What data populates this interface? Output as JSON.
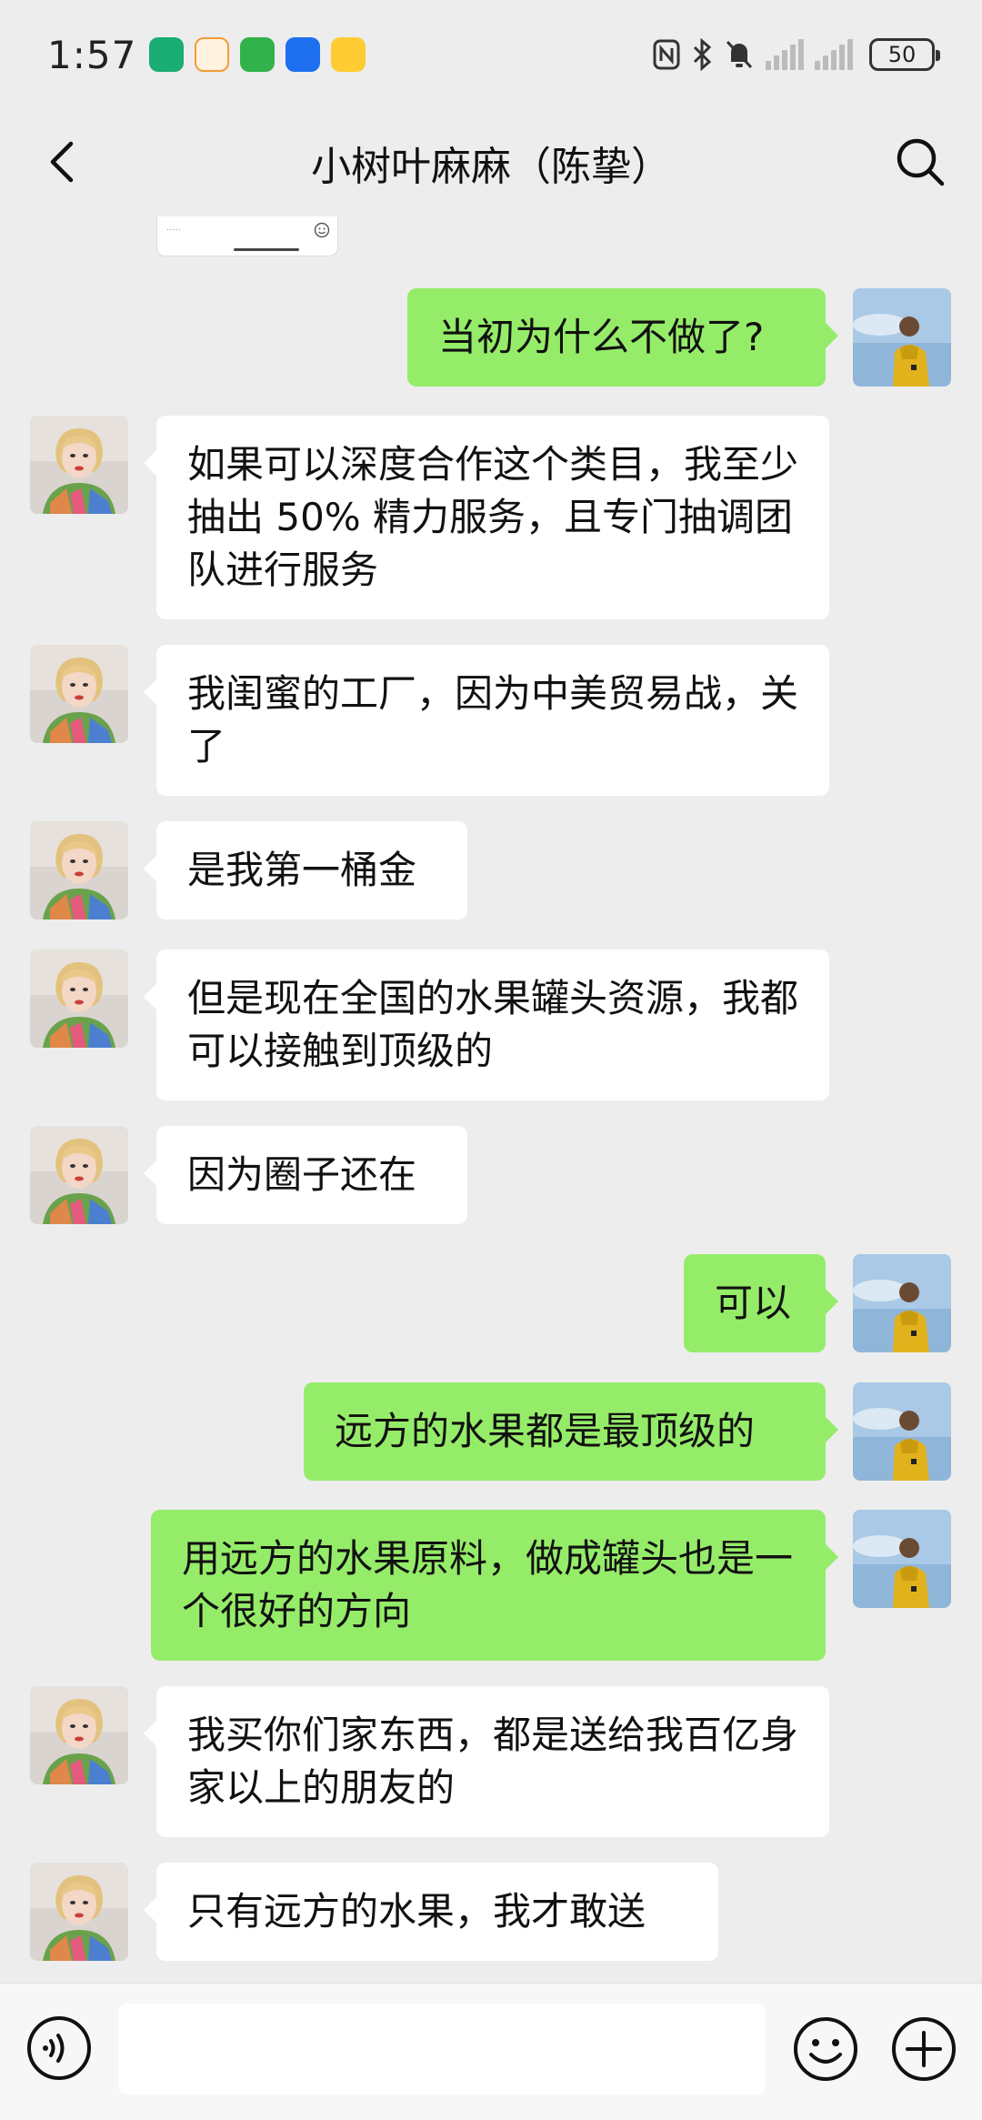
{
  "status_bar": {
    "time": "1:57",
    "battery": "50",
    "app_icons": [
      "app-green-icon",
      "app-orange-icon",
      "app-green-square-icon",
      "app-blue-plane-icon",
      "app-yellow-duck-icon"
    ],
    "status_icons": [
      "nfc-icon",
      "bluetooth-icon",
      "mute-icon",
      "signal-1-icon",
      "signal-2-icon",
      "battery-icon"
    ]
  },
  "header": {
    "title": "小树叶麻麻（陈挚）",
    "back_icon": "chevron-left-icon",
    "search_icon": "search-icon"
  },
  "messages": [
    {
      "side": "right",
      "text": "当初为什么不做了?"
    },
    {
      "side": "left",
      "text": "如果可以深度合作这个类目，我至少抽出 50% 精力服务，且专门抽调团队进行服务"
    },
    {
      "side": "left",
      "text": "我闺蜜的工厂，因为中美贸易战，关了"
    },
    {
      "side": "left",
      "text": "是我第一桶金"
    },
    {
      "side": "left",
      "text": "但是现在全国的水果罐头资源，我都可以接触到顶级的"
    },
    {
      "side": "left",
      "text": "因为圈子还在"
    },
    {
      "side": "right",
      "text": "可以"
    },
    {
      "side": "right",
      "text": "远方的水果都是最顶级的"
    },
    {
      "side": "right",
      "text": "用远方的水果原料，做成罐头也是一个很好的方向"
    },
    {
      "side": "left",
      "text": "我买你们家东西，都是送给我百亿身家以上的朋友的"
    },
    {
      "side": "left",
      "text": "只有远方的水果，我才敢送"
    }
  ],
  "input_bar": {
    "voice_icon": "voice-icon",
    "emoji_icon": "emoji-icon",
    "plus_icon": "plus-icon",
    "placeholder": ""
  },
  "colors": {
    "background": "#ededed",
    "bubble_self": "#95ec69",
    "bubble_other": "#ffffff"
  }
}
